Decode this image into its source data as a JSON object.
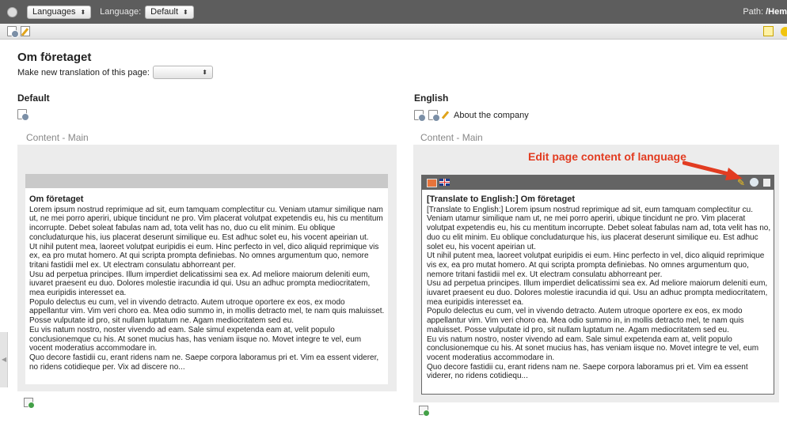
{
  "topbar": {
    "view_select": "Languages",
    "language_label": "Language:",
    "language_select": "Default",
    "path_label": "Path:",
    "path_value": "/Hem"
  },
  "page": {
    "title": "Om företaget",
    "new_translation_label": "Make new translation of this page:",
    "new_translation_select": ""
  },
  "columns": {
    "default": {
      "heading": "Default",
      "section_label": "Content - Main",
      "element_title": "Om företaget",
      "element_body": [
        "Lorem ipsum nostrud reprimique ad sit, eum tamquam complectitur cu. Veniam utamur similique nam ut, ne mei porro aperiri, ubique tincidunt ne pro. Vim placerat volutpat expetendis eu, his cu mentitum incorrupte. Debet soleat fabulas nam ad, tota velit has no, duo cu elit minim. Eu oblique concludaturque his, ius placerat deserunt similique eu. Est adhuc solet eu, his vocent apeirian ut.",
        "Ut nihil putent mea, laoreet volutpat euripidis ei eum. Hinc perfecto in vel, dico aliquid reprimique vis ex, ea pro mutat homero. At qui scripta prompta definiebas. No omnes argumentum quo, nemore tritani fastidii mel ex. Ut electram consulatu abhorreant per.",
        "Usu ad perpetua principes. Illum imperdiet delicatissimi sea ex. Ad meliore maiorum deleniti eum, iuvaret praesent eu duo. Dolores molestie iracundia id qui. Usu an adhuc prompta mediocritatem, mea euripidis interesset ea.",
        "Populo delectus eu cum, vel in vivendo detracto. Autem utroque oportere ex eos, ex modo appellantur vim. Vim veri choro ea. Mea odio summo in, in mollis detracto mel, te nam quis maluisset. Posse vulputate id pro, sit nullam luptatum ne. Agam mediocritatem sed eu.",
        "Eu vis natum nostro, noster vivendo ad eam. Sale simul expetenda eam at, velit populo conclusionemque cu his. At sonet mucius has, has veniam iisque no. Movet integre te vel, eum vocent moderatius accommodare in.",
        "Quo decore fastidii cu, erant ridens nam ne. Saepe corpora laboramus pri et. Vim ea essent viderer, no ridens cotidieque per. Vix ad discere no..."
      ]
    },
    "english": {
      "heading": "English",
      "page_title_label": "About the company",
      "section_label": "Content - Main",
      "element_title": "[Translate to English:] Om företaget",
      "element_body": [
        "[Translate to English:] Lorem ipsum nostrud reprimique ad sit, eum tamquam complectitur cu. Veniam utamur similique nam ut, ne mei porro aperiri, ubique tincidunt ne pro. Vim placerat volutpat expetendis eu, his cu mentitum incorrupte. Debet soleat fabulas nam ad, tota velit has no, duo cu elit minim. Eu oblique concludaturque his, ius placerat deserunt similique eu. Est adhuc solet eu, his vocent apeirian ut.",
        "Ut nihil putent mea, laoreet volutpat euripidis ei eum. Hinc perfecto in vel, dico aliquid reprimique vis ex, ea pro mutat homero. At qui scripta prompta definiebas. No omnes argumentum quo, nemore tritani fastidii mel ex. Ut electram consulatu abhorreant per.",
        "Usu ad perpetua principes. Illum imperdiet delicatissimi sea ex. Ad meliore maiorum deleniti eum, iuvaret praesent eu duo. Dolores molestie iracundia id qui. Usu an adhuc prompta mediocritatem, mea euripidis interesset ea.",
        "Populo delectus eu cum, vel in vivendo detracto. Autem utroque oportere ex eos, ex modo appellantur vim. Vim veri choro ea. Mea odio summo in, in mollis detracto mel, te nam quis maluisset. Posse vulputate id pro, sit nullam luptatum ne. Agam mediocritatem sed eu.",
        "Eu vis natum nostro, noster vivendo ad eam. Sale simul expetenda eam at, velit populo conclusionemque cu his. At sonet mucius has, has veniam iisque no. Movet integre te vel, eum vocent moderatius accommodare in.",
        "Quo decore fastidii cu, erant ridens nam ne. Saepe corpora laboramus pri et. Vim ea essent viderer, no ridens cotidiequ..."
      ]
    }
  },
  "annotation": {
    "text": "Edit page content of language",
    "color": "#e23c21"
  },
  "icons": {
    "page": "page-icon",
    "edit": "pencil-icon",
    "flag": "uk-flag-icon",
    "visibility": "eye-icon",
    "delete": "trash-icon",
    "add": "add-content-icon"
  }
}
